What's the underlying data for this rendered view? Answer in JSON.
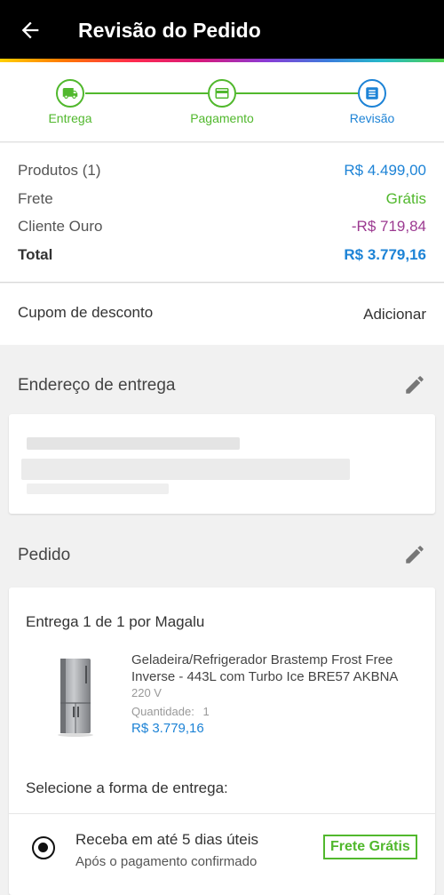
{
  "header": {
    "title": "Revisão do Pedido",
    "back_icon": "arrow-left-icon"
  },
  "steps": [
    {
      "label": "Entrega",
      "icon": "truck-icon",
      "state": "done"
    },
    {
      "label": "Pagamento",
      "icon": "card-icon",
      "state": "done"
    },
    {
      "label": "Revisão",
      "icon": "document-icon",
      "state": "active"
    }
  ],
  "summary": {
    "products_label": "Produtos (1)",
    "products_value": "R$ 4.499,00",
    "shipping_label": "Frete",
    "shipping_value": "Grátis",
    "club_label": "Cliente Ouro",
    "club_value": "-R$ 719,84",
    "total_label": "Total",
    "total_value": "R$ 3.779,16"
  },
  "coupon": {
    "label": "Cupom de desconto",
    "action": "Adicionar"
  },
  "address": {
    "title": "Endereço de entrega",
    "edit_icon": "pencil-icon"
  },
  "order": {
    "title": "Pedido",
    "edit_icon": "pencil-icon",
    "delivery_title": "Entrega 1 de 1 por Magalu",
    "product": {
      "name": "Geladeira/Refrigerador Brastemp Frost Free Inverse - 443L com Turbo Ice BRE57 AKBNA",
      "voltage": "220 V",
      "quantity_label": "Quantidade:",
      "quantity": "1",
      "price": "R$ 3.779,16"
    },
    "select_label": "Selecione a forma de entrega:",
    "option": {
      "title": "Receba em até 5 dias úteis",
      "subtitle": "Após o pagamento confirmado",
      "badge": "Frete Grátis"
    }
  },
  "colors": {
    "accent_blue": "#1d83d6",
    "accent_green": "#51b82d",
    "club_purple": "#9c3a91"
  }
}
